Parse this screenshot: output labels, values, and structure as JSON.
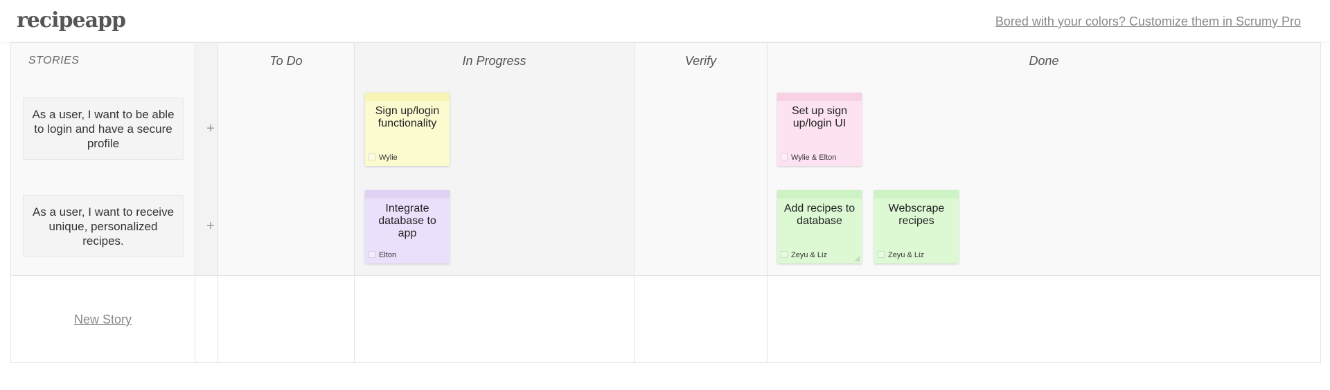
{
  "app": {
    "logo": "recipeapp",
    "promo_link": "Bored with your colors? Customize them in Scrumy Pro"
  },
  "columns": {
    "stories": "STORIES",
    "todo": "To Do",
    "in_progress": "In Progress",
    "verify": "Verify",
    "done": "Done"
  },
  "stories": [
    {
      "text": "As a user, I want to be able to login and have a secure profile",
      "add": "+"
    },
    {
      "text": "As a user, I want to receive unique, personalized recipes.",
      "add": "+"
    }
  ],
  "tasks": [
    {
      "title": "Sign up/login functionality",
      "owner": "Wylie",
      "color": "#fcfbd0",
      "column": "In Progress"
    },
    {
      "title": "Set up sign up/login UI",
      "owner": "Wylie & Elton",
      "color": "#fde3f2",
      "column": "Done"
    },
    {
      "title": "Integrate database to app",
      "owner": "Elton",
      "color": "#ebe0fb",
      "column": "In Progress"
    },
    {
      "title": "Add recipes to database",
      "owner": "Zeyu & Liz",
      "color": "#dcf9d4",
      "column": "Done"
    },
    {
      "title": "Webscrape recipes",
      "owner": "Zeyu & Liz",
      "color": "#dcf9d4",
      "column": "Done"
    }
  ],
  "new_story": "New Story"
}
